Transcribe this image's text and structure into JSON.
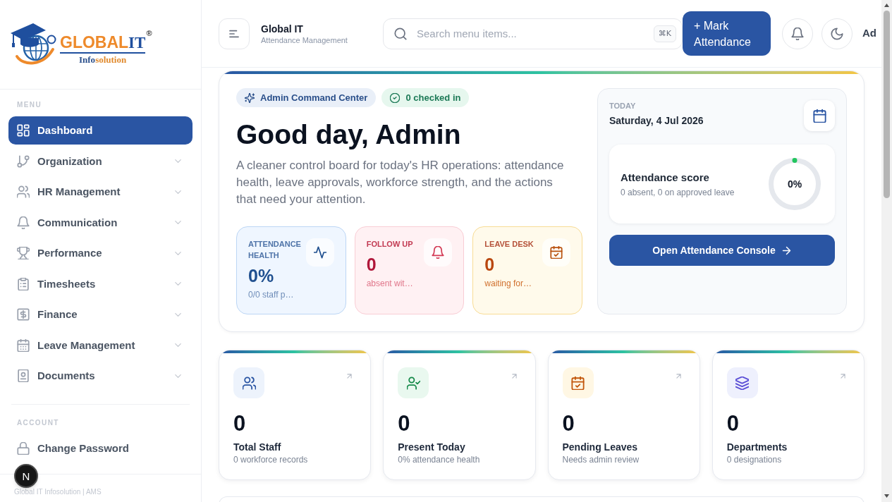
{
  "sidebar": {
    "brand": {
      "name_primary": "GLOBAL",
      "name_accent": "IT",
      "registered": "®",
      "tagline_primary": "Info",
      "tagline_accent": "solution"
    },
    "sections": [
      {
        "title": "MENU",
        "items": [
          {
            "label": "Dashboard",
            "kind": "link",
            "selected": true
          },
          {
            "label": "Organization",
            "kind": "group",
            "selected": false,
            "expanded": false
          },
          {
            "label": "HR Management",
            "kind": "group",
            "selected": false,
            "expanded": false
          },
          {
            "label": "Communication",
            "kind": "group",
            "selected": false,
            "expanded": false
          },
          {
            "label": "Performance",
            "kind": "group",
            "selected": false,
            "expanded": false
          },
          {
            "label": "Timesheets",
            "kind": "group",
            "selected": false,
            "expanded": false
          },
          {
            "label": "Finance",
            "kind": "group",
            "selected": false,
            "expanded": false
          },
          {
            "label": "Leave Management",
            "kind": "group",
            "selected": false,
            "expanded": false
          },
          {
            "label": "Documents",
            "kind": "group",
            "selected": false,
            "expanded": false
          }
        ]
      },
      {
        "title": "ACCOUNT",
        "items": [
          {
            "label": "Change Password",
            "kind": "link",
            "selected": false
          }
        ]
      }
    ],
    "footer": "Global IT Infosolution | AMS"
  },
  "dev_indicator": {
    "label": "N"
  },
  "header": {
    "app_name": "Global IT",
    "app_subtitle": "Attendance Management",
    "search": {
      "placeholder": "Search menu items...",
      "shortcut": "⌘K"
    },
    "primary_action": "+ Mark Attendance",
    "user": "Ad"
  },
  "hero": {
    "badges": [
      {
        "label": "Admin Command Center",
        "kind": "role"
      },
      {
        "label": "0 checked in",
        "kind": "status"
      }
    ],
    "title": "Good day, Admin",
    "description": "A cleaner control board for today's HR operations: attendance health, leave approvals, workforce strength, and the actions that need your attention.",
    "highlights": [
      {
        "label": "ATTENDANCE HEALTH",
        "value": "0%",
        "note": "0/0 staff p…",
        "kind": "health"
      },
      {
        "label": "FOLLOW UP",
        "value": "0",
        "note": "absent wit…",
        "kind": "alert"
      },
      {
        "label": "LEAVE DESK",
        "value": "0",
        "note": "waiting for…",
        "kind": "pending"
      }
    ],
    "today": {
      "label": "TODAY",
      "date": "Saturday, 4 Jul 2026",
      "score": {
        "title": "Attendance score",
        "note": "0 absent, 0 on approved leave",
        "value": "0%",
        "level": 0
      },
      "action": "Open Attendance Console"
    }
  },
  "stats": [
    {
      "value": "0",
      "label": "Total Staff",
      "note": "0 workforce records",
      "kind": "staff"
    },
    {
      "value": "0",
      "label": "Present Today",
      "note": "0% attendance health",
      "kind": "present"
    },
    {
      "value": "0",
      "label": "Pending Leaves",
      "note": "Needs admin review",
      "kind": "leave"
    },
    {
      "value": "0",
      "label": "Departments",
      "note": "0 designations",
      "kind": "departments"
    }
  ]
}
